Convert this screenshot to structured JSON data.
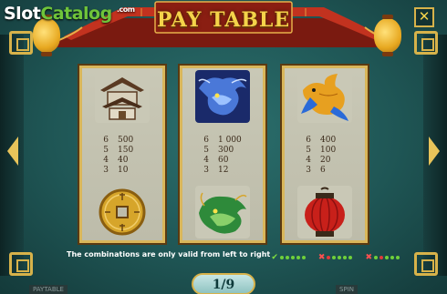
{
  "logo": {
    "slot": "Slot",
    "catalog": "Catalog",
    "com": ".com"
  },
  "title": "PAY TABLE",
  "close_label": "✕",
  "columns": [
    {
      "top_symbol": "pagoda-icon",
      "bottom_symbol": "coin-icon",
      "pays": [
        [
          "6",
          "500"
        ],
        [
          "5",
          "150"
        ],
        [
          "4",
          "40"
        ],
        [
          "3",
          "10"
        ]
      ]
    },
    {
      "top_symbol": "blue-dragon-icon",
      "bottom_symbol": "green-dragon-icon",
      "pays": [
        [
          "6",
          "1 000"
        ],
        [
          "5",
          "300"
        ],
        [
          "4",
          "60"
        ],
        [
          "3",
          "12"
        ]
      ]
    },
    {
      "top_symbol": "koi-fish-icon",
      "bottom_symbol": "red-lantern-icon",
      "pays": [
        [
          "6",
          "400"
        ],
        [
          "5",
          "100"
        ],
        [
          "4",
          "20"
        ],
        [
          "3",
          "6"
        ]
      ]
    }
  ],
  "note": "The combinations are only valid from left to right",
  "page": "1/9",
  "ghost": {
    "paytable": "PAYTABLE",
    "spin": "SPIN"
  },
  "colors": {
    "gold": "#d7b24a",
    "title": "#f4d34a",
    "teal": "#1f5655",
    "roof_red": "#b52a1c"
  },
  "line_indicators": [
    {
      "mark": "check",
      "dots": [
        "g",
        "g",
        "g",
        "g",
        "g"
      ]
    },
    {
      "mark": "cross",
      "dots": [
        "r",
        "g",
        "g",
        "g",
        "g"
      ]
    },
    {
      "mark": "cross",
      "dots": [
        "g",
        "r",
        "g",
        "g",
        "g"
      ]
    }
  ]
}
